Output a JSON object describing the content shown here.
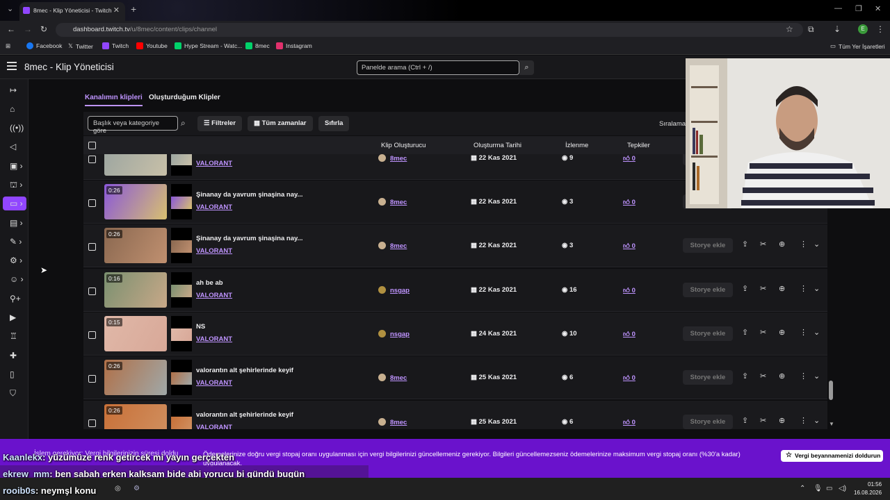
{
  "browser": {
    "tab_title": "8mec - Klip Yöneticisi - Twitch",
    "url_host": "dashboard.twitch.tv",
    "url_path": "/u/8mec/content/clips/channel",
    "bookmarks": [
      {
        "label": "Facebook",
        "color": "#1877f2"
      },
      {
        "label": "Twitter",
        "color": "#ffffff"
      },
      {
        "label": "Twitch",
        "color": "#9146ff"
      },
      {
        "label": "Youtube",
        "color": "#ff0000"
      },
      {
        "label": "Hype Stream - Watc...",
        "color": "#00ff7f"
      },
      {
        "label": "8mec",
        "color": "#00ff7f"
      },
      {
        "label": "Instagram",
        "color": "#e1306c"
      }
    ],
    "all_bookmarks": "Tüm Yer İşaretleri"
  },
  "header": {
    "title": "8mec - Klip Yöneticisi",
    "search_placeholder": "Panelde arama (Ctrl + /)"
  },
  "tabs": {
    "channel_clips": "Kanalımın klipleri",
    "my_clips": "Oluşturduğum Klipler"
  },
  "filters": {
    "search_placeholder": "Başlık veya kategoriye göre",
    "filters": "Filtreler",
    "all_time": "Tüm zamanlar",
    "reset": "Sıfırla",
    "sort": "Sıralama"
  },
  "table": {
    "headers": {
      "creator": "Klip Oluşturucu",
      "date": "Oluşturma Tarihi",
      "views": "İzlenme",
      "reactions": "Tepkiler"
    },
    "story_label": "Storye ekle",
    "rows": [
      {
        "duration": "",
        "title": "",
        "game": "VALORANT",
        "creator": "8mec",
        "date": "22 Kas 2021",
        "views": "9",
        "likes": "0",
        "c1": "#9aa4a0",
        "c2": "#c8c0a8"
      },
      {
        "duration": "0:26",
        "title": "Şinanay da yavrum şinaşina nay...",
        "game": "VALORANT",
        "creator": "8mec",
        "date": "22 Kas 2021",
        "views": "3",
        "likes": "0",
        "c1": "#8a58d8",
        "c2": "#d8c070"
      },
      {
        "duration": "0:26",
        "title": "Şinanay da yavrum şinaşina nay...",
        "game": "VALORANT",
        "creator": "8mec",
        "date": "22 Kas 2021",
        "views": "3",
        "likes": "0",
        "c1": "#8a6850",
        "c2": "#c09070"
      },
      {
        "duration": "0:16",
        "title": "ah be ab",
        "game": "VALORANT",
        "creator": "nsgap",
        "date": "22 Kas 2021",
        "views": "16",
        "likes": "0",
        "c1": "#7a9070",
        "c2": "#c8a888"
      },
      {
        "duration": "0:15",
        "title": "NS",
        "game": "VALORANT",
        "creator": "nsgap",
        "date": "24 Kas 2021",
        "views": "10",
        "likes": "0",
        "c1": "#e0b8a8",
        "c2": "#d8a898"
      },
      {
        "duration": "0:26",
        "title": "valorantın alt şehirlerinde keyif",
        "game": "VALORANT",
        "creator": "8mec",
        "date": "25 Kas 2021",
        "views": "6",
        "likes": "0",
        "c1": "#b07048",
        "c2": "#a0a8a8"
      },
      {
        "duration": "0:26",
        "title": "valorantın alt şehirlerinde keyif",
        "game": "VALORANT",
        "creator": "8mec",
        "date": "25 Kas 2021",
        "views": "6",
        "likes": "0",
        "c1": "#c87038",
        "c2": "#d09060"
      }
    ]
  },
  "banner": {
    "title": "İşlem gerekiyor: Vergi bilgilerinizin süresi doldu",
    "text": "Ödemelerinize doğru vergi stopaj oranı uygulanması için vergi bilgilerinizi güncellemeniz gerekiyor. Bilgileri güncellemezseniz ödemelerinize maksimum vergi stopaj oranı (%30'a kadar) uygulanacak.",
    "button": "Vergi beyannamenizi doldurun"
  },
  "chat": [
    {
      "user": "Kaanlekx",
      "msg": ": yüzümüze renk getircek mi yayın gerçekten"
    },
    {
      "user": "ekrew_mm",
      "msg": ": ben sabah erken kalksam bide abi yorucu bi gündü bugün"
    },
    {
      "user": "rooib0s",
      "msg": ": neymşl konu"
    }
  ],
  "taskbar": {
    "time": "01:56",
    "date": "16.08.2026"
  }
}
